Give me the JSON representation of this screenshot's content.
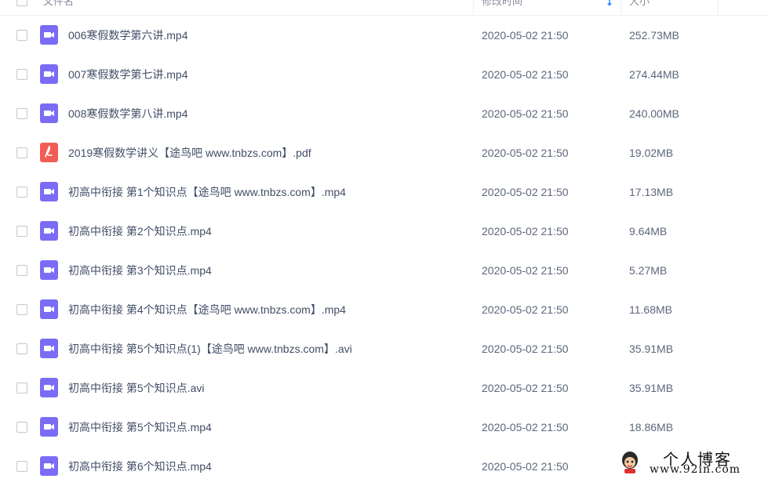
{
  "header": {
    "name_label": "文件名",
    "date_label": "修改时间",
    "size_label": "大小"
  },
  "files": [
    {
      "name": "006寒假数学第六讲.mp4",
      "date": "2020-05-02 21:50",
      "size": "252.73MB",
      "type": "video"
    },
    {
      "name": "007寒假数学第七讲.mp4",
      "date": "2020-05-02 21:50",
      "size": "274.44MB",
      "type": "video"
    },
    {
      "name": "008寒假数学第八讲.mp4",
      "date": "2020-05-02 21:50",
      "size": "240.00MB",
      "type": "video"
    },
    {
      "name": "2019寒假数学讲义【途鸟吧 www.tnbzs.com】.pdf",
      "date": "2020-05-02 21:50",
      "size": "19.02MB",
      "type": "pdf"
    },
    {
      "name": "初高中衔接 第1个知识点【途鸟吧 www.tnbzs.com】.mp4",
      "date": "2020-05-02 21:50",
      "size": "17.13MB",
      "type": "video"
    },
    {
      "name": "初高中衔接 第2个知识点.mp4",
      "date": "2020-05-02 21:50",
      "size": "9.64MB",
      "type": "video"
    },
    {
      "name": "初高中衔接 第3个知识点.mp4",
      "date": "2020-05-02 21:50",
      "size": "5.27MB",
      "type": "video"
    },
    {
      "name": "初高中衔接 第4个知识点【途鸟吧 www.tnbzs.com】.mp4",
      "date": "2020-05-02 21:50",
      "size": "11.68MB",
      "type": "video"
    },
    {
      "name": "初高中衔接 第5个知识点(1)【途鸟吧 www.tnbzs.com】.avi",
      "date": "2020-05-02 21:50",
      "size": "35.91MB",
      "type": "video"
    },
    {
      "name": "初高中衔接 第5个知识点.avi",
      "date": "2020-05-02 21:50",
      "size": "35.91MB",
      "type": "video"
    },
    {
      "name": "初高中衔接 第5个知识点.mp4",
      "date": "2020-05-02 21:50",
      "size": "18.86MB",
      "type": "video"
    },
    {
      "name": "初高中衔接 第6个知识点.mp4",
      "date": "2020-05-02 21:50",
      "size": "",
      "type": "video"
    }
  ],
  "watermark": {
    "title": "个人博客",
    "url": "www.92in.com"
  },
  "colors": {
    "video_icon": "#7b6cf6",
    "pdf_icon": "#f25c54",
    "text": "#424e67",
    "sort_arrow": "#3b8cff"
  },
  "icons": {
    "video": "video-file-icon",
    "pdf": "pdf-file-icon",
    "sort": "sort-desc-icon"
  }
}
